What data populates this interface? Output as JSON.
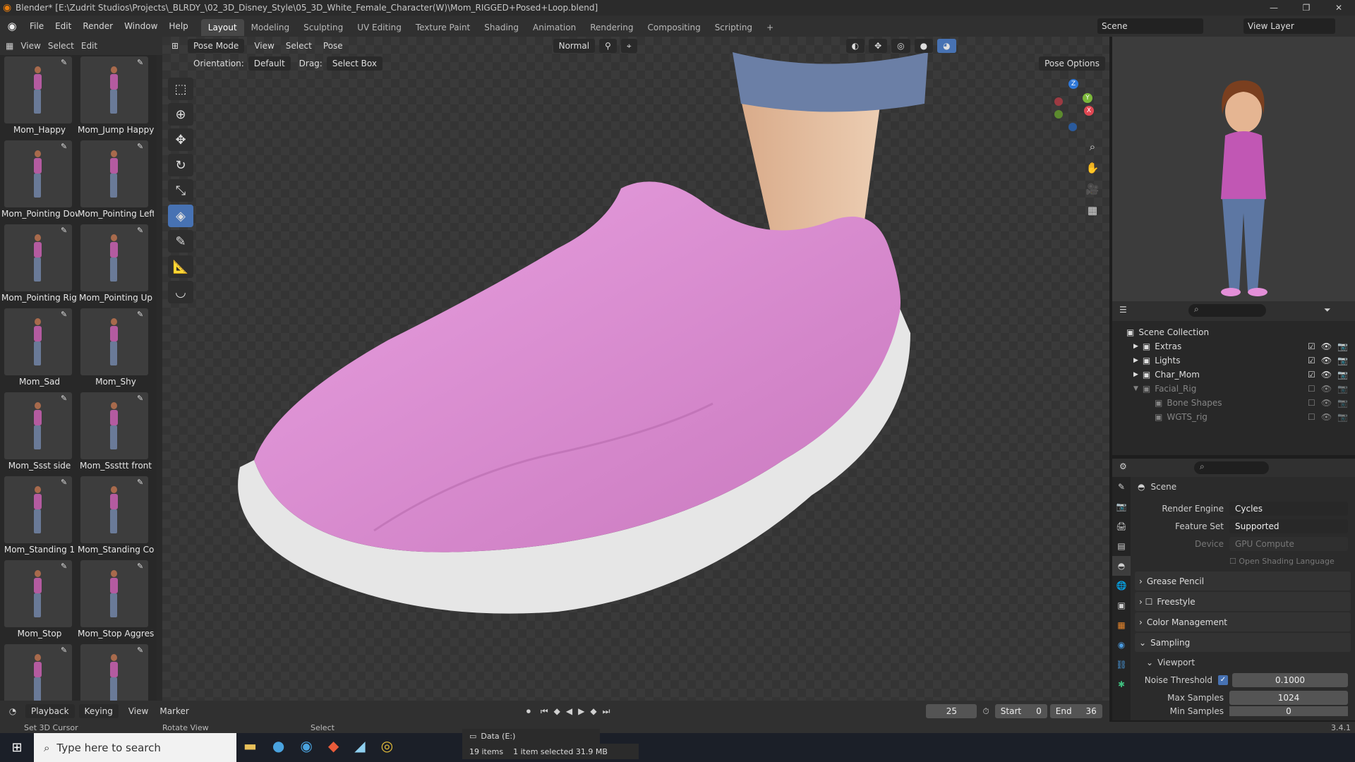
{
  "window": {
    "title": "Blender* [E:\\Zudrit Studios\\Projects\\_BLRDY_\\02_3D_Disney_Style\\05_3D_White_Female_Character(W)\\Mom_RIGGED+Posed+Loop.blend]",
    "controls": [
      "—",
      "❐",
      "✕"
    ]
  },
  "menubar": {
    "menus": [
      "File",
      "Edit",
      "Render",
      "Window",
      "Help"
    ],
    "workspaces": [
      "Layout",
      "Modeling",
      "Sculpting",
      "UV Editing",
      "Texture Paint",
      "Shading",
      "Animation",
      "Rendering",
      "Compositing",
      "Scripting"
    ],
    "active_workspace": "Layout",
    "scene": "Scene",
    "view_layer": "View Layer"
  },
  "asset_browser": {
    "menus": [
      "View",
      "Select",
      "Edit"
    ],
    "assets": [
      "Mom_Happy",
      "Mom_Jump Happy",
      "Mom_Pointing Down",
      "Mom_Pointing Left",
      "Mom_Pointing Right",
      "Mom_Pointing Up",
      "Mom_Sad",
      "Mom_Shy",
      "Mom_Ssst side",
      "Mom_Sssttt front",
      "Mom_Standing 1",
      "Mom_Standing Co...",
      "Mom_Stop",
      "Mom_Stop Aggres...",
      "",
      ""
    ]
  },
  "viewport": {
    "mode": "Pose Mode",
    "menus": [
      "View",
      "Select",
      "Pose"
    ],
    "transform_orientation": "Normal",
    "orientation_label": "Orientation:",
    "orientation_value": "Default",
    "drag_label": "Drag:",
    "drag_value": "Select Box",
    "pose_options": "Pose Options",
    "colors": {
      "shoe": "#d98ad0",
      "sole": "#e8e8e8",
      "jeans": "#6b7fa6",
      "skin": "#e9c2a2"
    }
  },
  "timeline": {
    "menus": [
      "Playback",
      "Keying",
      "View",
      "Marker"
    ],
    "current_frame": "25",
    "start_label": "Start",
    "start": "0",
    "end_label": "End",
    "end": "36"
  },
  "statusbar": {
    "left": "Set 3D Cursor",
    "middle": "Rotate View",
    "right": "Select",
    "version": "3.4.1"
  },
  "outliner": {
    "root": "Scene Collection",
    "items": [
      {
        "name": "Extras",
        "enabled": true
      },
      {
        "name": "Lights",
        "enabled": true
      },
      {
        "name": "Char_Mom",
        "enabled": true
      },
      {
        "name": "Facial_Rig",
        "enabled": false
      },
      {
        "name": "Bone Shapes",
        "enabled": false
      },
      {
        "name": "WGTS_rig",
        "enabled": false
      }
    ]
  },
  "properties": {
    "context": "Scene",
    "render_engine_label": "Render Engine",
    "render_engine": "Cycles",
    "feature_set_label": "Feature Set",
    "feature_set": "Supported",
    "device_label": "Device",
    "device": "GPU Compute",
    "osl": "Open Shading Language",
    "sections": [
      "Grease Pencil",
      "Freestyle",
      "Color Management",
      "Sampling"
    ],
    "viewport_sub": "Viewport",
    "noise_threshold_label": "Noise Threshold",
    "noise_threshold": "0.1000",
    "max_samples_label": "Max Samples",
    "max_samples": "1024",
    "min_samples_label": "Min Samples",
    "min_samples": "0"
  },
  "taskbar": {
    "search_placeholder": "Type here to search",
    "drive": "Data (E:)",
    "items_count": "19 items",
    "selection": "1 item selected  31.9 MB"
  }
}
